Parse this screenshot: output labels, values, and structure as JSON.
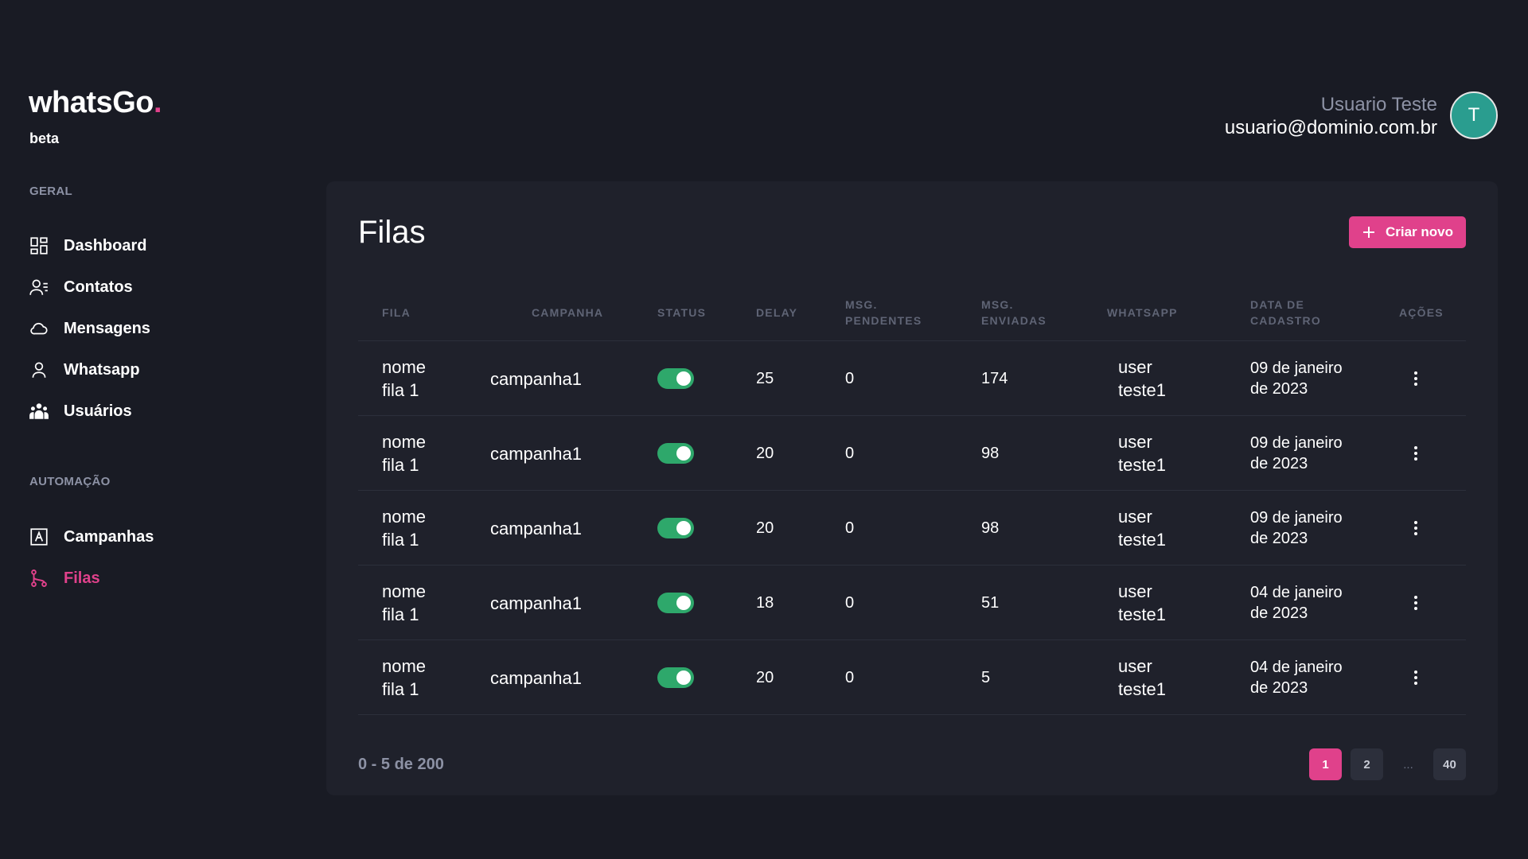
{
  "brand": {
    "name": "whatsGo",
    "dot": ".",
    "tag": "beta"
  },
  "user": {
    "name": "Usuario Teste",
    "email": "usuario@dominio.com.br",
    "initial": "T"
  },
  "sidebar": {
    "section_general": "GERAL",
    "general_items": [
      {
        "label": "Dashboard",
        "icon": "dashboard-icon"
      },
      {
        "label": "Contatos",
        "icon": "contacts-icon"
      },
      {
        "label": "Mensagens",
        "icon": "cloud-icon"
      },
      {
        "label": "Whatsapp",
        "icon": "user-icon"
      },
      {
        "label": "Usuários",
        "icon": "users-group-icon"
      }
    ],
    "section_automation": "AUTOMAÇÃO",
    "automation_items": [
      {
        "label": "Campanhas",
        "icon": "campaign-icon"
      },
      {
        "label": "Filas",
        "icon": "branch-icon",
        "active": true
      }
    ]
  },
  "page": {
    "title": "Filas",
    "create_label": "Criar novo"
  },
  "table": {
    "headers": {
      "fila": "FILA",
      "campanha": "CAMPANHA",
      "status": "STATUS",
      "delay": "DELAY",
      "pendentes_1": "MSG.",
      "pendentes_2": "PENDENTES",
      "enviadas_1": "MSG.",
      "enviadas_2": "ENVIADAS",
      "whatsapp": "WHATSAPP",
      "data_1": "DATA DE",
      "data_2": "CADASTRO",
      "acoes": "AÇÕES"
    },
    "rows": [
      {
        "fila": "nome fila 1",
        "campanha": "campanha1",
        "status": true,
        "delay": "25",
        "pendentes": "0",
        "enviadas": "174",
        "whatsapp": "user teste1",
        "data": "09 de janeiro de 2023"
      },
      {
        "fila": "nome fila 1",
        "campanha": "campanha1",
        "status": true,
        "delay": "20",
        "pendentes": "0",
        "enviadas": "98",
        "whatsapp": "user teste1",
        "data": "09 de janeiro de 2023"
      },
      {
        "fila": "nome fila 1",
        "campanha": "campanha1",
        "status": true,
        "delay": "20",
        "pendentes": "0",
        "enviadas": "98",
        "whatsapp": "user teste1",
        "data": "09 de janeiro de 2023"
      },
      {
        "fila": "nome fila 1",
        "campanha": "campanha1",
        "status": true,
        "delay": "18",
        "pendentes": "0",
        "enviadas": "51",
        "whatsapp": "user teste1",
        "data": "04 de janeiro de 2023"
      },
      {
        "fila": "nome fila 1",
        "campanha": "campanha1",
        "status": true,
        "delay": "20",
        "pendentes": "0",
        "enviadas": "5",
        "whatsapp": "user teste1",
        "data": "04 de janeiro de 2023"
      }
    ]
  },
  "footer": {
    "range_label": "0 - 5 de 200",
    "pages": [
      "1",
      "2"
    ],
    "ellipsis": "...",
    "last_page": "40",
    "current_page": "1"
  },
  "colors": {
    "accent": "#e0418b",
    "toggle_on": "#2ea86b",
    "avatar": "#2a9d8f",
    "background": "#191b24",
    "card": "#1f212b"
  }
}
